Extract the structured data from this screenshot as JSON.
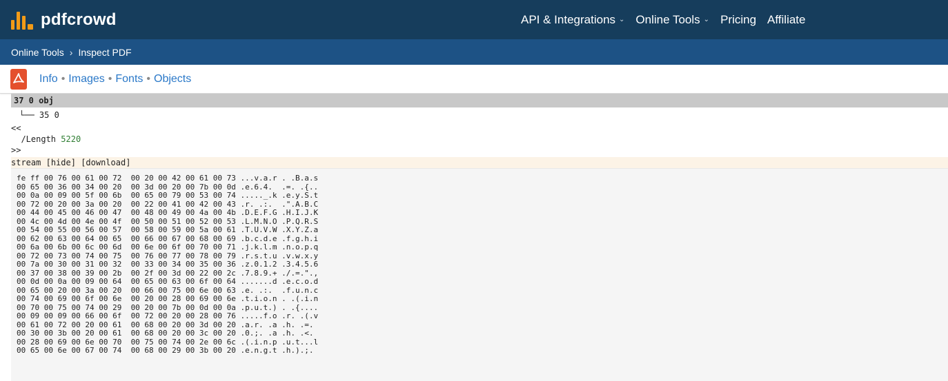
{
  "header": {
    "brand": "pdfcrowd",
    "nav": [
      {
        "label": "API & Integrations",
        "dropdown": true
      },
      {
        "label": "Online Tools",
        "dropdown": true
      },
      {
        "label": "Pricing",
        "dropdown": false
      },
      {
        "label": "Affiliate",
        "dropdown": false
      }
    ]
  },
  "breadcrumb": {
    "items": [
      "Online Tools",
      "Inspect PDF"
    ],
    "separator": "›"
  },
  "tabs": [
    "Info",
    "Images",
    "Fonts",
    "Objects"
  ],
  "object": {
    "header": "37 0 obj",
    "ref": "└── 35 0",
    "dict_open": "<<",
    "length_key": "/Length",
    "length_value": "5220",
    "dict_close": ">>",
    "stream_label": "stream",
    "hide_link": "[hide]",
    "download_link": "[download]"
  },
  "hexdump": [
    "fe ff 00 76 00 61 00 72  00 20 00 42 00 61 00 73 ...v.a.r . .B.a.s",
    "00 65 00 36 00 34 00 20  00 3d 00 20 00 7b 00 0d .e.6.4.  .=. .{..",
    "00 0a 00 09 00 5f 00 6b  00 65 00 79 00 53 00 74 ....._.k .e.y.S.t",
    "00 72 00 20 00 3a 00 20  00 22 00 41 00 42 00 43 .r. .:.  .\".A.B.C",
    "00 44 00 45 00 46 00 47  00 48 00 49 00 4a 00 4b .D.E.F.G .H.I.J.K",
    "00 4c 00 4d 00 4e 00 4f  00 50 00 51 00 52 00 53 .L.M.N.O .P.Q.R.S",
    "00 54 00 55 00 56 00 57  00 58 00 59 00 5a 00 61 .T.U.V.W .X.Y.Z.a",
    "00 62 00 63 00 64 00 65  00 66 00 67 00 68 00 69 .b.c.d.e .f.g.h.i",
    "00 6a 00 6b 00 6c 00 6d  00 6e 00 6f 00 70 00 71 .j.k.l.m .n.o.p.q",
    "00 72 00 73 00 74 00 75  00 76 00 77 00 78 00 79 .r.s.t.u .v.w.x.y",
    "00 7a 00 30 00 31 00 32  00 33 00 34 00 35 00 36 .z.0.1.2 .3.4.5.6",
    "00 37 00 38 00 39 00 2b  00 2f 00 3d 00 22 00 2c .7.8.9.+ ./.=.\".,",
    "00 0d 00 0a 00 09 00 64  00 65 00 63 00 6f 00 64 .......d .e.c.o.d",
    "00 65 00 20 00 3a 00 20  00 66 00 75 00 6e 00 63 .e. .:.  .f.u.n.c",
    "00 74 00 69 00 6f 00 6e  00 20 00 28 00 69 00 6e .t.i.o.n . .(.i.n",
    "00 70 00 75 00 74 00 29  00 20 00 7b 00 0d 00 0a .p.u.t.) . .{....",
    "00 09 00 09 00 66 00 6f  00 72 00 20 00 28 00 76 .....f.o .r. .(.v",
    "00 61 00 72 00 20 00 61  00 68 00 20 00 3d 00 20 .a.r. .a .h. .=. ",
    "00 30 00 3b 00 20 00 61  00 68 00 20 00 3c 00 20 .0.;. .a .h. .<. ",
    "00 28 00 69 00 6e 00 70  00 75 00 74 00 2e 00 6c .(.i.n.p .u.t...l",
    "00 65 00 6e 00 67 00 74  00 68 00 29 00 3b 00 20 .e.n.g.t .h.).;. "
  ],
  "colors": {
    "topbar": "#163d5c",
    "subbar": "#1d5285",
    "accent": "#f29b17",
    "link": "#2a78c8",
    "pdf_icon": "#e4502d"
  }
}
